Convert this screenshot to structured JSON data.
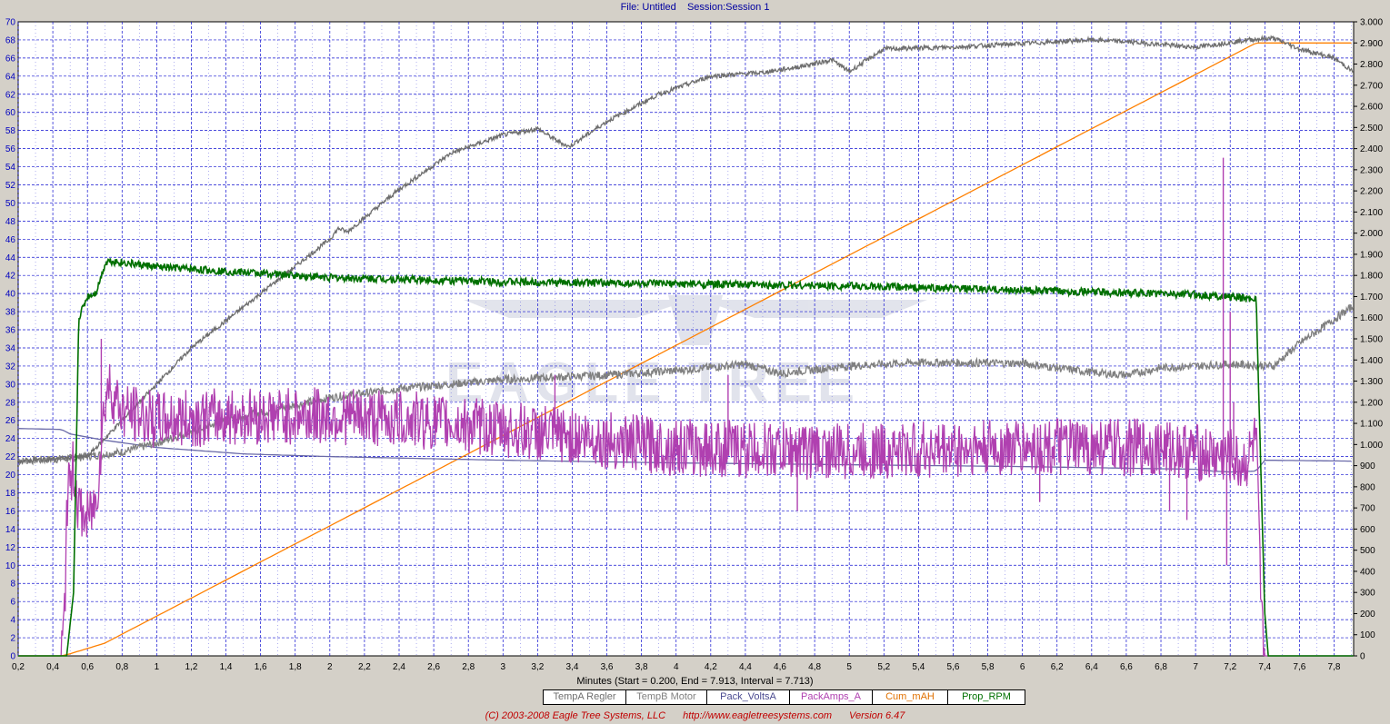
{
  "window": {
    "file_label": "File: Untitled",
    "session_label": "Session:Session 1"
  },
  "footer": {
    "copyright": "(C) 2003-2008 Eagle Tree Systems, LLC",
    "url": "http://www.eagletreesystems.com",
    "version": "Version 6.47"
  },
  "chart_data": {
    "type": "line",
    "xlabel": "Minutes (Start = 0.200,  End = 7.913,  Interval =  7.713)",
    "xlim": [
      0.2,
      7.913
    ],
    "ylim_left": [
      0,
      70
    ],
    "ylim_right": [
      0,
      3000
    ],
    "grid": true,
    "legend_position": "bottom-center",
    "x_ticks": [
      "0,2",
      "0,4",
      "0,6",
      "0,8",
      "1",
      "1,2",
      "1,4",
      "1,6",
      "1,8",
      "2",
      "2,2",
      "2,4",
      "2,6",
      "2,8",
      "3",
      "3,2",
      "3,4",
      "3,6",
      "3,8",
      "4",
      "4,2",
      "4,4",
      "4,6",
      "4,8",
      "5",
      "5,2",
      "5,4",
      "5,6",
      "5,8",
      "6",
      "6,2",
      "6,4",
      "6,6",
      "6,8",
      "7",
      "7,2",
      "7,4",
      "7,6",
      "7,8"
    ],
    "y_left_ticks": [
      "0",
      "2",
      "4",
      "6",
      "8",
      "10",
      "12",
      "14",
      "16",
      "18",
      "20",
      "22",
      "24",
      "26",
      "28",
      "30",
      "32",
      "34",
      "36",
      "38",
      "40",
      "42",
      "44",
      "46",
      "48",
      "50",
      "52",
      "54",
      "56",
      "58",
      "60",
      "62",
      "64",
      "66",
      "68",
      "70"
    ],
    "y_right_ticks": [
      "0",
      "100",
      "200",
      "300",
      "400",
      "500",
      "600",
      "700",
      "800",
      "900",
      "1.000",
      "1.100",
      "1.200",
      "1.300",
      "1.400",
      "1.500",
      "1.600",
      "1.700",
      "1.800",
      "1.900",
      "2.000",
      "2.100",
      "2.200",
      "2.300",
      "2.400",
      "2.500",
      "2.600",
      "2.700",
      "2.800",
      "2.900",
      "3.000"
    ],
    "series": [
      {
        "name": "TempA Regler",
        "axis": "left",
        "color": "#6e6e6e",
        "noise": 0.25,
        "x": [
          0.2,
          0.6,
          0.9,
          1.2,
          1.6,
          2.0,
          2.05,
          2.1,
          2.4,
          2.7,
          3.0,
          3.2,
          3.3,
          3.38,
          3.6,
          3.9,
          4.2,
          4.5,
          4.7,
          4.9,
          5.0,
          5.2,
          5.6,
          6.0,
          6.4,
          6.6,
          6.8,
          7.0,
          7.3,
          7.45,
          7.6,
          7.8,
          7.91
        ],
        "y": [
          21.5,
          22,
          28,
          34,
          40,
          46,
          47.2,
          46.8,
          51.5,
          55.5,
          57.5,
          58.2,
          57,
          56.2,
          59,
          62,
          64,
          64.4,
          65,
          65.8,
          64.5,
          67,
          67.2,
          67.6,
          68,
          67.8,
          67.5,
          67.2,
          68,
          68.2,
          67,
          66,
          64.5
        ]
      },
      {
        "name": "TempB Motor",
        "axis": "left",
        "color": "#808080",
        "noise": 0.45,
        "x": [
          0.2,
          0.5,
          0.8,
          1.0,
          1.4,
          2.0,
          2.4,
          3.0,
          3.6,
          4.0,
          4.4,
          4.6,
          5.0,
          5.4,
          6.0,
          6.4,
          6.6,
          6.8,
          7.0,
          7.2,
          7.45,
          7.6,
          7.91
        ],
        "y": [
          21.5,
          21.8,
          22.5,
          23.5,
          26,
          28.5,
          29.5,
          30.5,
          31,
          31.5,
          32.2,
          31.2,
          32,
          32.4,
          32.3,
          31.3,
          31,
          31.8,
          32,
          32.2,
          32,
          34.5,
          38.6
        ]
      },
      {
        "name": "Pack_VoltsA",
        "axis": "left",
        "color": "#6a6aa8",
        "noise": 0,
        "x": [
          0.2,
          0.45,
          0.5,
          0.7,
          1.0,
          1.5,
          2.0,
          3.0,
          4.0,
          5.0,
          6.0,
          7.0,
          7.1,
          7.2,
          7.35,
          7.4,
          7.91
        ],
        "y": [
          25.1,
          25,
          24.5,
          23.8,
          23,
          22.3,
          22,
          21.6,
          21.3,
          21.1,
          20.9,
          20.6,
          20.4,
          20.3,
          20.4,
          21.6,
          21.5
        ]
      },
      {
        "name": "PackAmps_A",
        "axis": "left",
        "color": "#b040b0",
        "noise": 3.2,
        "x": [
          0.2,
          0.45,
          0.47,
          0.48,
          0.52,
          0.55,
          0.6,
          0.65,
          0.7,
          0.72,
          0.8,
          1.0,
          1.5,
          2.0,
          2.5,
          3.0,
          3.5,
          4.0,
          5.0,
          6.0,
          6.8,
          7.0,
          7.1,
          7.2,
          7.25,
          7.3,
          7.35,
          7.38,
          7.4,
          7.91
        ],
        "y": [
          0,
          0,
          5,
          17,
          21,
          16,
          15,
          17,
          28,
          30,
          27,
          26,
          26.5,
          26.5,
          26,
          25,
          24,
          23,
          22.5,
          23,
          23,
          22.5,
          22,
          22,
          21,
          21.5,
          24,
          4,
          0,
          0
        ]
      },
      {
        "name": "Cum_mAH",
        "axis": "right",
        "color": "#ff8000",
        "noise": 0,
        "x": [
          0.2,
          0.45,
          0.5,
          0.7,
          7.35,
          7.91
        ],
        "y": [
          0,
          0,
          10,
          60,
          2900,
          2900
        ]
      },
      {
        "name": "Prop_RPM",
        "axis": "right",
        "color": "#007000",
        "noise": 18,
        "x": [
          0.2,
          0.48,
          0.52,
          0.55,
          0.6,
          0.65,
          0.7,
          0.72,
          1.0,
          1.6,
          2.0,
          3.0,
          4.0,
          5.0,
          6.0,
          7.0,
          7.15,
          7.2,
          7.3,
          7.35,
          7.4,
          7.42,
          7.91
        ],
        "y": [
          0,
          0,
          300,
          1600,
          1700,
          1720,
          1850,
          1870,
          1840,
          1810,
          1790,
          1770,
          1760,
          1750,
          1730,
          1710,
          1700,
          1700,
          1690,
          1690,
          200,
          0,
          0
        ]
      }
    ],
    "spikes": [
      {
        "series": "PackAmps_A",
        "x": [
          0.68,
          1.8,
          3.3,
          4.3,
          4.7,
          6.1,
          6.75,
          6.85,
          6.95,
          7.16,
          7.18,
          7.2,
          7.22
        ],
        "y": [
          35,
          29,
          31,
          31,
          16,
          17,
          20,
          16,
          15,
          55,
          10,
          38,
          28
        ]
      }
    ]
  }
}
